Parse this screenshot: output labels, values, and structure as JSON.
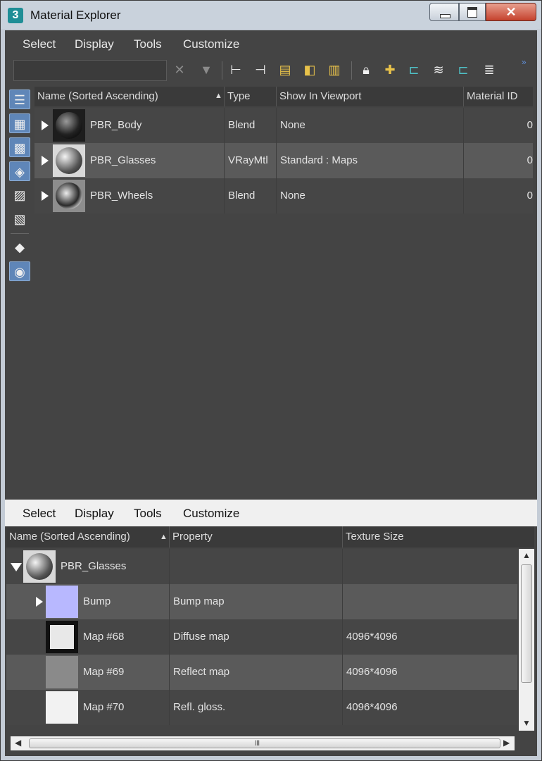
{
  "window": {
    "title": "Material Explorer",
    "app_icon": "3"
  },
  "menu_top": [
    "Select",
    "Display",
    "Tools",
    "Customize"
  ],
  "menu_bottom": [
    "Select",
    "Display",
    "Tools",
    "Customize"
  ],
  "toolbar": {
    "search_value": "",
    "icons": [
      "close-icon",
      "filter-icon",
      "hierarchy-icon",
      "hierarchy-alt-icon",
      "doc-select-icon",
      "doc-icon",
      "doc-edit-icon",
      "lock-icon",
      "add-layer-icon",
      "tree-teal-icon",
      "stack-icon",
      "tree-teal-alt-icon",
      "layers-icon"
    ]
  },
  "top_grid": {
    "columns": [
      "Name (Sorted Ascending)",
      "Type",
      "Show In Viewport",
      "Material ID"
    ],
    "rows": [
      {
        "name": "PBR_Body",
        "type": "Blend",
        "viewport": "None",
        "id": "0"
      },
      {
        "name": "PBR_Glasses",
        "type": "VRayMtl",
        "viewport": "Standard : Maps",
        "id": "0"
      },
      {
        "name": "PBR_Wheels",
        "type": "Blend",
        "viewport": "None",
        "id": "0"
      }
    ],
    "selected_row": 1
  },
  "bottom_grid": {
    "columns": [
      "Name (Sorted Ascending)",
      "Property",
      "Texture Size"
    ],
    "parent": {
      "name": "PBR_Glasses"
    },
    "rows": [
      {
        "name": "Bump",
        "property": "Bump map",
        "size": "",
        "swatch": "#b8b8ff"
      },
      {
        "name": "Map #68",
        "property": "Diffuse map",
        "size": "4096*4096",
        "swatch": "#e8e8e8"
      },
      {
        "name": "Map #69",
        "property": "Reflect map",
        "size": "4096*4096",
        "swatch": "#8a8a8a"
      },
      {
        "name": "Map #70",
        "property": "Refl. gloss.",
        "size": "4096*4096",
        "swatch": "#f2f2f2"
      }
    ]
  },
  "scroll_grip": "III",
  "colors": {
    "panel": "#444444",
    "selected": "#5a5a5a",
    "accent": "#5f86b8"
  }
}
